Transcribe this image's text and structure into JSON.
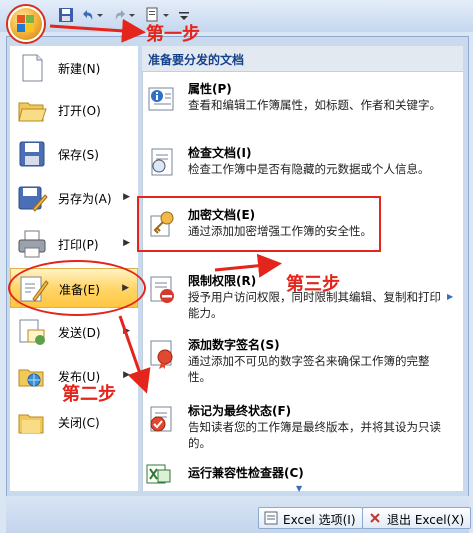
{
  "office_button": {
    "icon": "office-logo-icon"
  },
  "qat": {
    "icons": [
      "save-icon",
      "undo-icon",
      "redo-icon",
      "print-preview-icon",
      "customize-qat-icon"
    ]
  },
  "left_menu": {
    "items": [
      {
        "label": "新建(N)",
        "icon": "new-document-icon"
      },
      {
        "label": "打开(O)",
        "icon": "open-folder-icon"
      },
      {
        "label": "保存(S)",
        "icon": "save-disk-icon"
      },
      {
        "label": "另存为(A)",
        "icon": "save-as-icon",
        "submenu": true
      },
      {
        "label": "打印(P)",
        "icon": "printer-icon",
        "submenu": true
      },
      {
        "label": "准备(E)",
        "icon": "prepare-icon",
        "submenu": true,
        "active": true
      },
      {
        "label": "发送(D)",
        "icon": "send-icon",
        "submenu": true
      },
      {
        "label": "发布(U)",
        "icon": "publish-icon",
        "submenu": true
      },
      {
        "label": "关闭(C)",
        "icon": "close-folder-icon"
      }
    ]
  },
  "submenu": {
    "header": "准备要分发的文档",
    "items": [
      {
        "title": "属性(P)",
        "desc": "查看和编辑工作簿属性，如标题、作者和关键字。",
        "icon": "properties-icon"
      },
      {
        "title": "检查文档(I)",
        "desc": "检查工作簿中是否有隐藏的元数据或个人信息。",
        "icon": "inspect-document-icon"
      },
      {
        "title": "加密文档(E)",
        "desc": "通过添加加密增强工作簿的安全性。",
        "icon": "encrypt-key-icon"
      },
      {
        "title": "限制权限(R)",
        "desc": "授予用户访问权限，同时限制其编辑、复制和打印能力。",
        "icon": "restrict-permission-icon"
      },
      {
        "title": "添加数字签名(S)",
        "desc": "通过添加不可见的数字签名来确保工作簿的完整性。",
        "icon": "digital-signature-icon"
      },
      {
        "title": "标记为最终状态(F)",
        "desc": "告知读者您的工作簿是最终版本，并将其设为只读的。",
        "icon": "mark-final-icon"
      },
      {
        "title": "运行兼容性检查器(C)",
        "desc": "",
        "icon": "compatibility-checker-icon"
      }
    ]
  },
  "bottom": {
    "options_label": "Excel 选项(I)",
    "exit_label": "退出 Excel(X)"
  },
  "annotations": {
    "step1": "第一步",
    "step2": "第二步",
    "step3": "第三步"
  },
  "colors": {
    "annotation": "#e4251b",
    "active_item": "#ffd66b",
    "header_text": "#15428b"
  }
}
